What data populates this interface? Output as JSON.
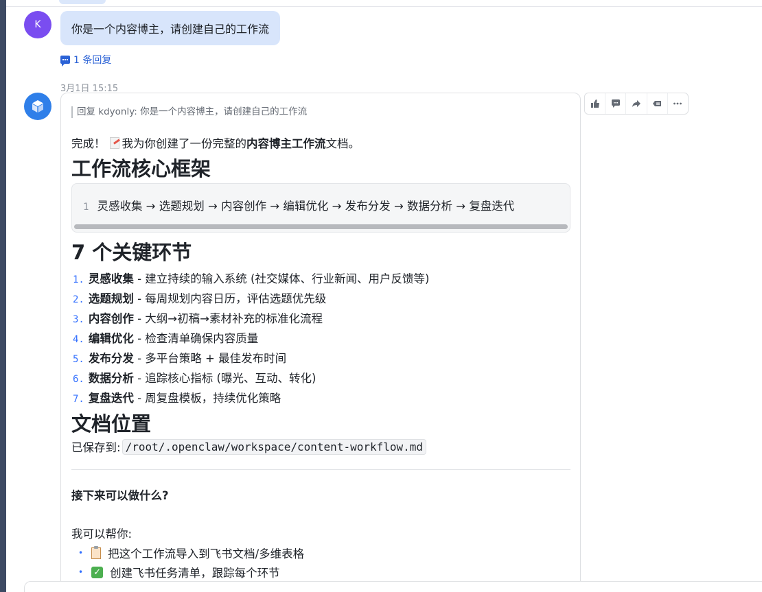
{
  "user_message": {
    "avatar_initial": "K",
    "text": "你是一个内容博主，请创建自己的工作流",
    "reply_count_label": "1 条回复"
  },
  "bot_message": {
    "timestamp": "3月1日 15:15",
    "quote": "回复 kdyonly: 你是一个内容博主，请创建自己的工作流",
    "intro_prefix": "完成！",
    "intro_middle": "我为你创建了一份完整的",
    "intro_bold": "内容博主工作流",
    "intro_suffix": "文档。",
    "section1_title": "工作流核心框架",
    "code_line_number": "1",
    "code_text": "灵感收集 → 选题规划 → 内容创作 → 编辑优化 → 发布分发 → 数据分析 → 复盘迭代",
    "section2_title": "7 个关键环节",
    "steps": [
      {
        "num": "1.",
        "title": "灵感收集",
        "desc": " - 建立持续的输入系统 (社交媒体、行业新闻、用户反馈等)"
      },
      {
        "num": "2.",
        "title": "选题规划",
        "desc": " - 每周规划内容日历，评估选题优先级"
      },
      {
        "num": "3.",
        "title": "内容创作",
        "desc": " - 大纲→初稿→素材补充的标准化流程"
      },
      {
        "num": "4.",
        "title": "编辑优化",
        "desc": " - 检查清单确保内容质量"
      },
      {
        "num": "5.",
        "title": "发布分发",
        "desc": " - 多平台策略 + 最佳发布时间"
      },
      {
        "num": "6.",
        "title": "数据分析",
        "desc": " - 追踪核心指标 (曝光、互动、转化)"
      },
      {
        "num": "7.",
        "title": "复盘迭代",
        "desc": " - 周复盘模板，持续优化策略"
      }
    ],
    "section3_title": "文档位置",
    "saved_label": "已保存到:",
    "saved_path": "/root/.openclaw/workspace/content-workflow.md",
    "next_title": "接下来可以做什么?",
    "help_label": "我可以帮你:",
    "help_items": [
      {
        "icon": "clipboard-icon",
        "text": "把这个工作流导入到飞书文档/多维表格"
      },
      {
        "icon": "check-box-icon",
        "text": "创建飞书任务清单，跟踪每个环节"
      }
    ]
  },
  "message_actions": [
    {
      "icon": "thumbs-up-icon",
      "glyph": "👍"
    },
    {
      "icon": "comment-icon",
      "glyph": "💬"
    },
    {
      "icon": "forward-icon",
      "glyph": "➦"
    },
    {
      "icon": "quote-reply-icon",
      "glyph": "▤"
    },
    {
      "icon": "more-icon",
      "glyph": "···"
    }
  ],
  "colors": {
    "accent": "#3370ff",
    "user_bubble": "#d8e5fb",
    "user_avatar": "#7a4df0",
    "bot_avatar": "#2f7fe9",
    "left_rail": "#3d4a63"
  }
}
